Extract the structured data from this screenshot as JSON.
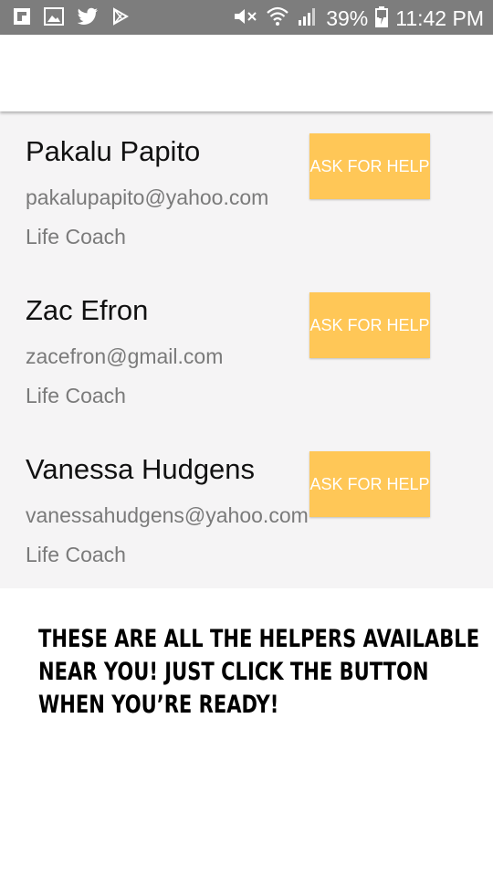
{
  "status_bar": {
    "battery": "39%",
    "time": "11:42 PM",
    "icons": [
      "flipboard-icon",
      "gallery-icon",
      "twitter-icon",
      "play-store-icon",
      "mute-icon",
      "wifi-icon",
      "signal-icon",
      "battery-charging-icon"
    ]
  },
  "helpers": [
    {
      "name": "Pakalu Papito",
      "email": "pakalupapito@yahoo.com",
      "role": "Life Coach",
      "button": "ASK FOR HELP"
    },
    {
      "name": "Zac Efron",
      "email": "zacefron@gmail.com",
      "role": "Life Coach",
      "button": "ASK FOR HELP"
    },
    {
      "name": "Vanessa Hudgens",
      "email": "vanessahudgens@yahoo.com",
      "role": "Life Coach",
      "button": "ASK FOR HELP"
    }
  ],
  "message": {
    "line1": "THESE ARE ALL THE HELPERS AVAILABLE",
    "line2": "NEAR YOU! JUST CLICK THE BUTTON",
    "line3": "WHEN YOU’RE READY!"
  },
  "colors": {
    "status_bar": "#7d7d7d",
    "button": "#ffc757",
    "list_background": "#f5f4f5"
  }
}
